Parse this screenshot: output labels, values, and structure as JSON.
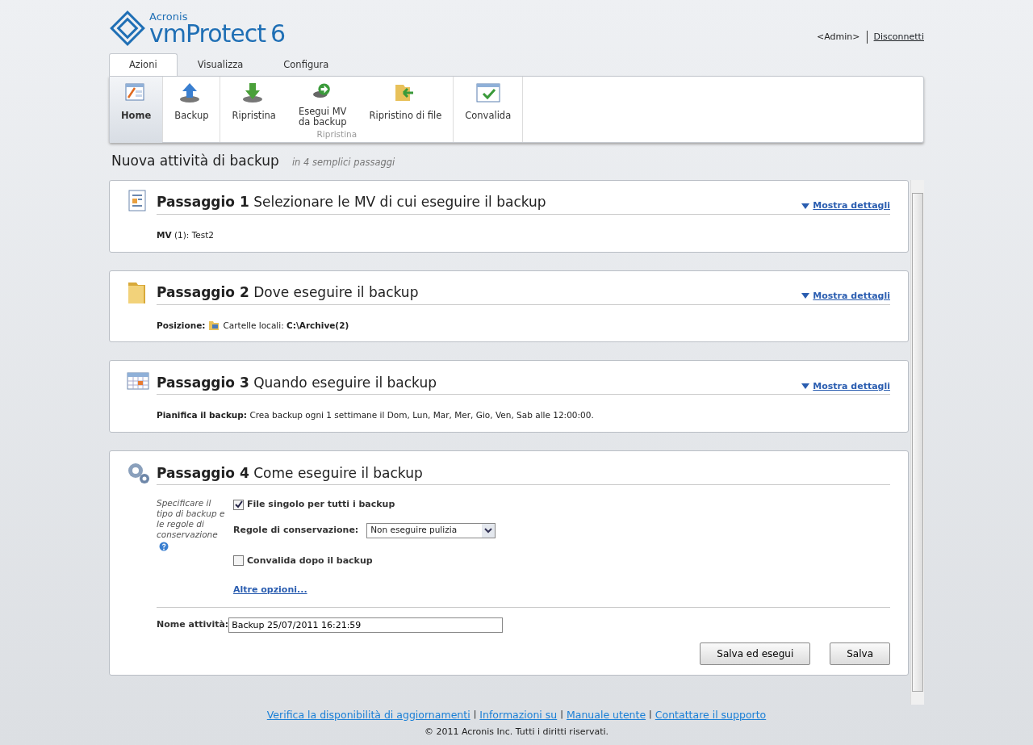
{
  "logo": {
    "brand": "Acronis",
    "product": "vmProtect",
    "version": "6"
  },
  "user": {
    "name": "<Admin>",
    "logout": "Disconnetti"
  },
  "tabs": [
    {
      "label": "Azioni",
      "selected": true
    },
    {
      "label": "Visualizza",
      "selected": false
    },
    {
      "label": "Configura",
      "selected": false
    }
  ],
  "ribbon": [
    {
      "items": [
        {
          "label": "Home",
          "selected": true
        }
      ]
    },
    {
      "items": [
        {
          "label": "Backup",
          "selected": false
        }
      ]
    },
    {
      "label": "Ripristina",
      "items": [
        {
          "label": "Ripristina",
          "selected": false
        },
        {
          "label": "Esegui MV\nda backup",
          "selected": false
        },
        {
          "label": "Ripristino di file",
          "selected": false
        }
      ]
    },
    {
      "items": [
        {
          "label": "Convalida",
          "selected": false
        }
      ]
    }
  ],
  "page": {
    "title": "Nuova attività di backup",
    "subtitle": "in 4 semplici passaggi"
  },
  "steps": [
    {
      "number": "Passaggio 1",
      "title": "Selezionare le MV di cui eseguire il backup",
      "details": "Mostra dettagli",
      "summary": {
        "kind": "text",
        "text": "**MV** (1): Test2"
      }
    },
    {
      "number": "Passaggio 2",
      "title": "Dove eseguire il backup",
      "details": "Mostra dettagli",
      "summary": {
        "kind": "location",
        "label": "Posizione:",
        "text": "Cartelle locali: **C:\\Archive(2)**"
      }
    },
    {
      "number": "Passaggio 3",
      "title": "Quando eseguire il backup",
      "details": "Mostra dettagli",
      "summary": {
        "kind": "text",
        "text": "**Pianifica il backup:** Crea backup ogni 1 settimane il Dom, Lun, Mar, Mer, Gio, Ven, Sab alle 12:00:00."
      }
    }
  ],
  "step4": {
    "number": "Passaggio 4",
    "title": "Come eseguire il backup",
    "hint": "Specificare il tipo di backup e le regole di conservazione",
    "options": [
      {
        "kind": "checkbox",
        "label": "File singolo per tutti i backup",
        "checked": true
      },
      {
        "kind": "select",
        "label": "Regole di conservazione:",
        "value": "Non eseguire pulizia"
      },
      {
        "kind": "checkbox",
        "label": "Convalida dopo il backup",
        "checked": false
      },
      {
        "kind": "link",
        "label": "Altre opzioni..."
      }
    ],
    "task_name": {
      "label": "Nome attività:",
      "value": "Backup 25/07/2011 16:21:59"
    },
    "buttons": [
      "Salva ed esegui",
      "Salva"
    ]
  },
  "footer": {
    "separator": "|",
    "links": [
      "Verifica la disponibilità di aggiornamenti",
      "Informazioni su",
      "Manuale utente",
      "Contattare il supporto"
    ],
    "copyright": "© 2011 Acronis Inc. Tutti i diritti riservati."
  }
}
